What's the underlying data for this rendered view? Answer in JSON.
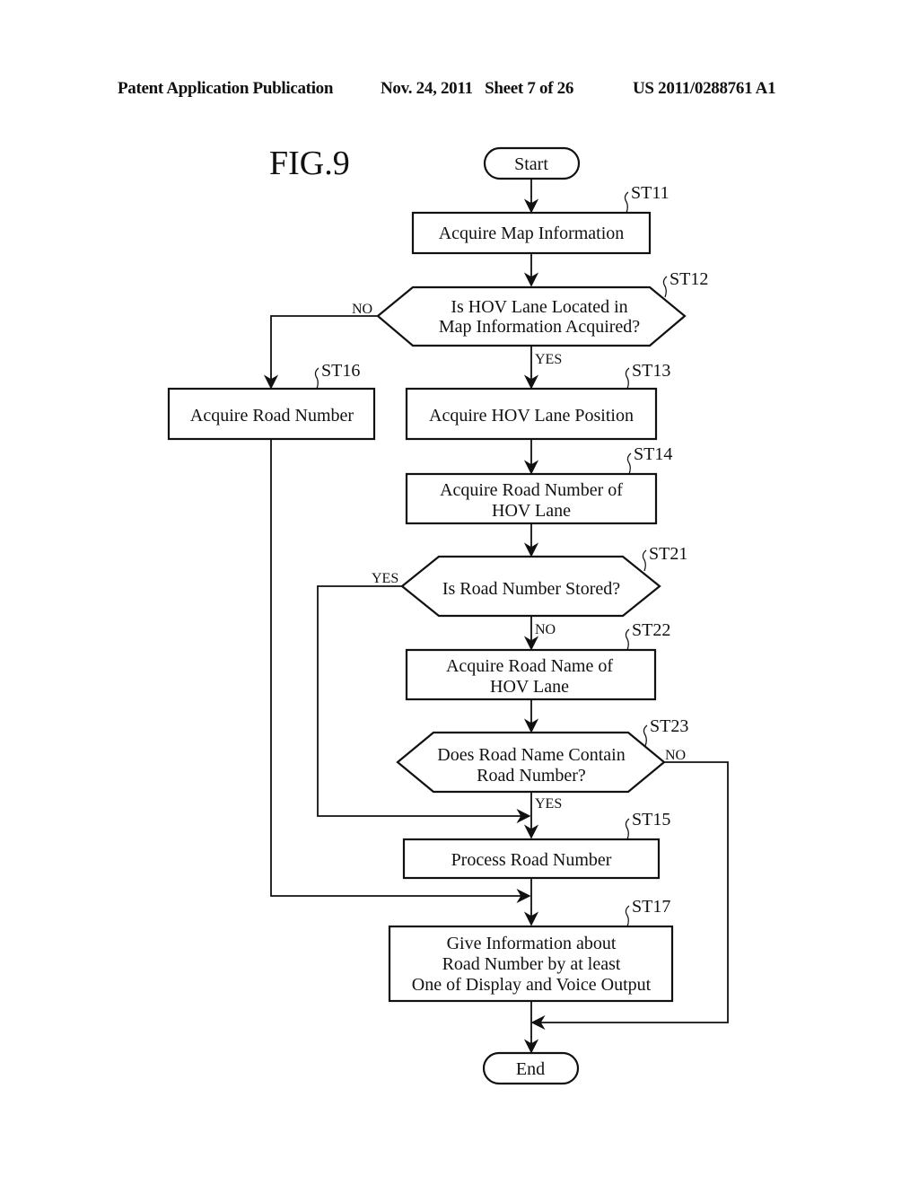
{
  "header": {
    "publication": "Patent Application Publication",
    "date_sheet": "Nov. 24, 2011   Sheet 7 of 26",
    "number": "US 2011/0288761 A1"
  },
  "figure": {
    "title": "FIG.9",
    "start": "Start",
    "end": "End",
    "steps": {
      "st11": {
        "id": "ST11",
        "lines": [
          "Acquire Map Information"
        ]
      },
      "st12": {
        "id": "ST12",
        "lines": [
          "Is HOV Lane Located in",
          "Map Information Acquired?"
        ]
      },
      "st13": {
        "id": "ST13",
        "lines": [
          "Acquire HOV Lane Position"
        ]
      },
      "st14": {
        "id": "ST14",
        "lines": [
          "Acquire Road Number of",
          "HOV Lane"
        ]
      },
      "st16": {
        "id": "ST16",
        "lines": [
          "Acquire Road Number"
        ]
      },
      "st21": {
        "id": "ST21",
        "lines": [
          "Is Road Number Stored?"
        ]
      },
      "st22": {
        "id": "ST22",
        "lines": [
          "Acquire Road Name of",
          "HOV Lane"
        ]
      },
      "st23": {
        "id": "ST23",
        "lines": [
          "Does Road Name Contain",
          "Road Number?"
        ]
      },
      "st15": {
        "id": "ST15",
        "lines": [
          "Process Road Number"
        ]
      },
      "st17": {
        "id": "ST17",
        "lines": [
          "Give Information about",
          "Road Number by at least",
          "One of Display and Voice Output"
        ]
      }
    },
    "branches": {
      "st12_no": "NO",
      "st12_yes": "YES",
      "st21_yes": "YES",
      "st21_no": "NO",
      "st23_no": "NO",
      "st23_yes": "YES"
    }
  }
}
